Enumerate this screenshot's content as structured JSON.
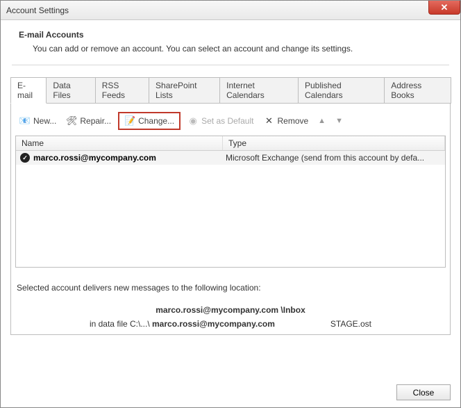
{
  "window": {
    "title": "Account Settings"
  },
  "header": {
    "title": "E-mail Accounts",
    "subtitle": "You can add or remove an account. You can select an account and change its settings."
  },
  "tabs": [
    {
      "label": "E-mail",
      "active": true
    },
    {
      "label": "Data Files"
    },
    {
      "label": "RSS Feeds"
    },
    {
      "label": "SharePoint Lists"
    },
    {
      "label": "Internet Calendars"
    },
    {
      "label": "Published Calendars"
    },
    {
      "label": "Address Books"
    }
  ],
  "toolbar": {
    "new": "New...",
    "repair": "Repair...",
    "change": "Change...",
    "set_default": "Set as Default",
    "remove": "Remove"
  },
  "list": {
    "columns": {
      "name": "Name",
      "type": "Type"
    },
    "rows": [
      {
        "name": "marco.rossi@mycompany.com",
        "type": "Microsoft Exchange (send from this account by defa..."
      }
    ]
  },
  "delivery": {
    "intro": "Selected account delivers new messages to the following location:",
    "target": "marco.rossi@mycompany.com \\Inbox",
    "file_prefix": "in data file C:\\...\\ ",
    "file_bold": "marco.rossi@mycompany.com",
    "file_suffix": "STAGE.ost"
  },
  "footer": {
    "close": "Close"
  }
}
